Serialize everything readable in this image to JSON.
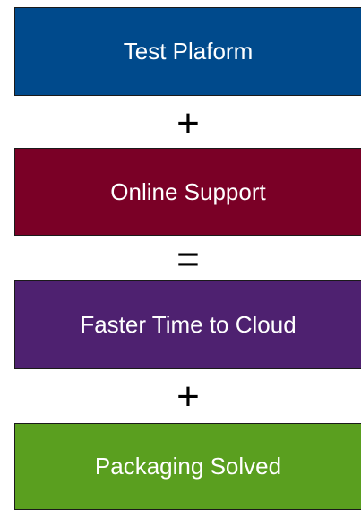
{
  "boxes": [
    {
      "label": "Test Plaform",
      "color": "#004a8c"
    },
    {
      "label": "Online Support",
      "color": "#7a0026"
    },
    {
      "label": "Faster Time to Cloud",
      "color": "#4e2170"
    },
    {
      "label": "Packaging Solved",
      "color": "#5a9f1f"
    }
  ],
  "operators": [
    "+",
    "=",
    "+"
  ]
}
